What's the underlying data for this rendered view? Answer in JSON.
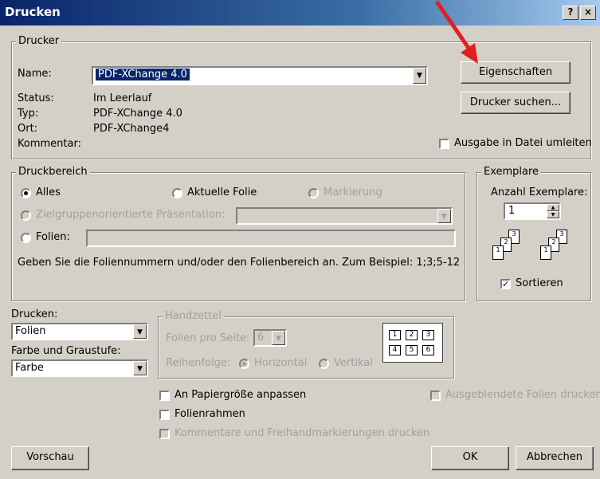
{
  "window": {
    "title": "Drucken",
    "help_button": "?",
    "close_button": "×"
  },
  "printer": {
    "group_label": "Drucker",
    "name_label": "Name:",
    "name_value": "PDF-XChange 4.0",
    "status_label": "Status:",
    "status_value": "Im Leerlauf",
    "type_label": "Typ:",
    "type_value": "PDF-XChange 4.0",
    "location_label": "Ort:",
    "location_value": "PDF-XChange4",
    "comment_label": "Kommentar:",
    "properties_button": "Eigenschaften",
    "find_printer_button": "Drucker suchen...",
    "print_to_file_label": "Ausgabe in Datei umleiten"
  },
  "print_range": {
    "group_label": "Druckbereich",
    "all_label": "Alles",
    "current_slide_label": "Aktuelle Folie",
    "selection_label": "Markierung",
    "custom_show_label": "Zielgruppenorientierte Präsentation:",
    "slides_label": "Folien:",
    "hint": "Geben Sie die Foliennummern und/oder den Folienbereich an. Zum Beispiel: 1;3;5-12"
  },
  "copies": {
    "group_label": "Exemplare",
    "count_label": "Anzahl Exemplare:",
    "count_value": "1",
    "collate_label": "Sortieren",
    "collate_checked": true,
    "collate_glyph": "✓",
    "pages_a": [
      "1",
      "2",
      "3"
    ],
    "pages_b": [
      "1",
      "2",
      "3"
    ]
  },
  "print_what": {
    "label": "Drucken:",
    "value": "Folien",
    "color_label": "Farbe und Graustufe:",
    "color_value": "Farbe"
  },
  "handouts": {
    "group_label": "Handzettel",
    "per_page_label": "Folien pro Seite:",
    "per_page_value": "6",
    "order_label": "Reihenfolge:",
    "horizontal_label": "Horizontal",
    "vertical_label": "Vertikal",
    "preview_cells": [
      "1",
      "2",
      "3",
      "4",
      "5",
      "6"
    ]
  },
  "options": {
    "scale_to_fit_label": "An Papiergröße anpassen",
    "frame_slides_label": "Folienrahmen",
    "comments_label": "Kommentare und Freihandmarkierungen drucken",
    "hidden_slides_label": "Ausgeblendete Folien drucken"
  },
  "footer": {
    "preview_button": "Vorschau",
    "ok_button": "OK",
    "cancel_button": "Abbrechen"
  },
  "annotation": {
    "arrow_color": "#e02020"
  },
  "icons": {
    "dropdown": "▼",
    "spin_up": "▲",
    "spin_down": "▼"
  }
}
